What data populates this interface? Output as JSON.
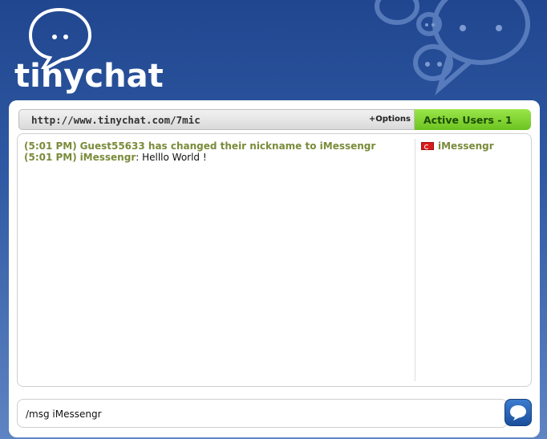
{
  "app": {
    "logo_text": "tinychat"
  },
  "header": {
    "room_url": "http://www.tinychat.com/7mic",
    "options_label": "+Options",
    "users_tab_label": "Active Users - 1"
  },
  "messages": [
    {
      "time": "(5:01 PM)",
      "system_text": "Guest55633 has changed their nickname to iMessengr"
    },
    {
      "time": "(5:01 PM)",
      "user": "iMessengr",
      "separator": ": ",
      "text": "Helllo World !"
    }
  ],
  "users": [
    {
      "name": "iMessengr",
      "flag_icon": "turkey-flag-icon"
    }
  ],
  "input": {
    "value": "/msg iMessengr"
  },
  "colors": {
    "accent_green": "#7a8b3a",
    "tab_green": "#6cc320",
    "background_blue": "#20468f",
    "send_button_blue": "#1a4f9c"
  }
}
